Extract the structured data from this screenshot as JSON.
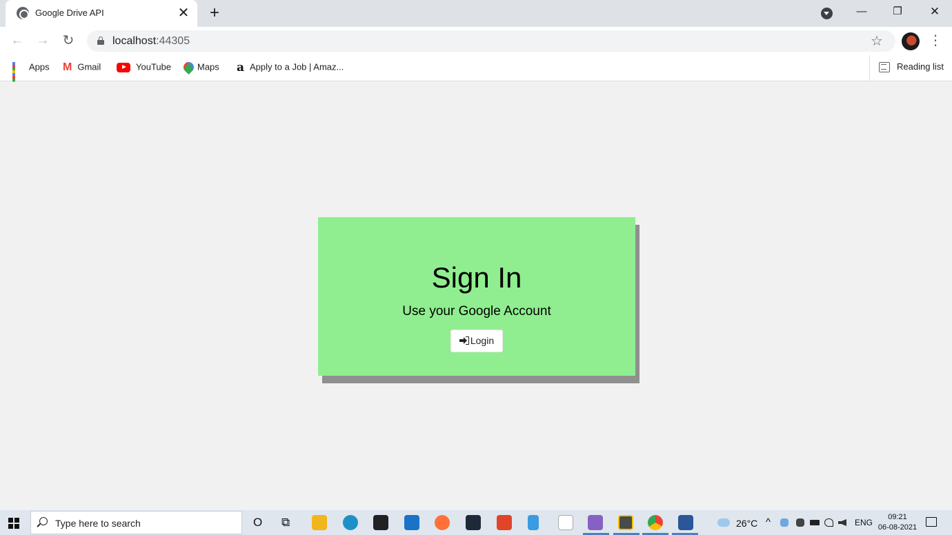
{
  "browser": {
    "tab_title": "Google Drive API",
    "tab_close": "✕",
    "new_tab": "+",
    "window_controls": {
      "minimize": "—",
      "restore": "❐",
      "close": "✕"
    }
  },
  "toolbar": {
    "back": "←",
    "forward": "→",
    "reload": "↻",
    "url_host": "localhost",
    "url_port": ":44305",
    "star": "☆",
    "menu": "⋮"
  },
  "bookmarks": {
    "items": [
      {
        "label": "Apps"
      },
      {
        "label": "Gmail",
        "icon_text": "M"
      },
      {
        "label": "YouTube"
      },
      {
        "label": "Maps"
      },
      {
        "label": "Apply to a Job | Amaz...",
        "icon_text": "a"
      }
    ],
    "reading_list": "Reading list"
  },
  "page": {
    "title": "Sign In",
    "subtitle": "Use your Google Account",
    "login_label": "Login",
    "card_color": "#90ee90"
  },
  "taskbar": {
    "search_placeholder": "Type here to search",
    "cortana": "O",
    "task_view": "⧉",
    "weather": "26°C",
    "tray_chevron": "^",
    "language": "ENG",
    "time": "09:21",
    "date": "06-08-2021"
  }
}
